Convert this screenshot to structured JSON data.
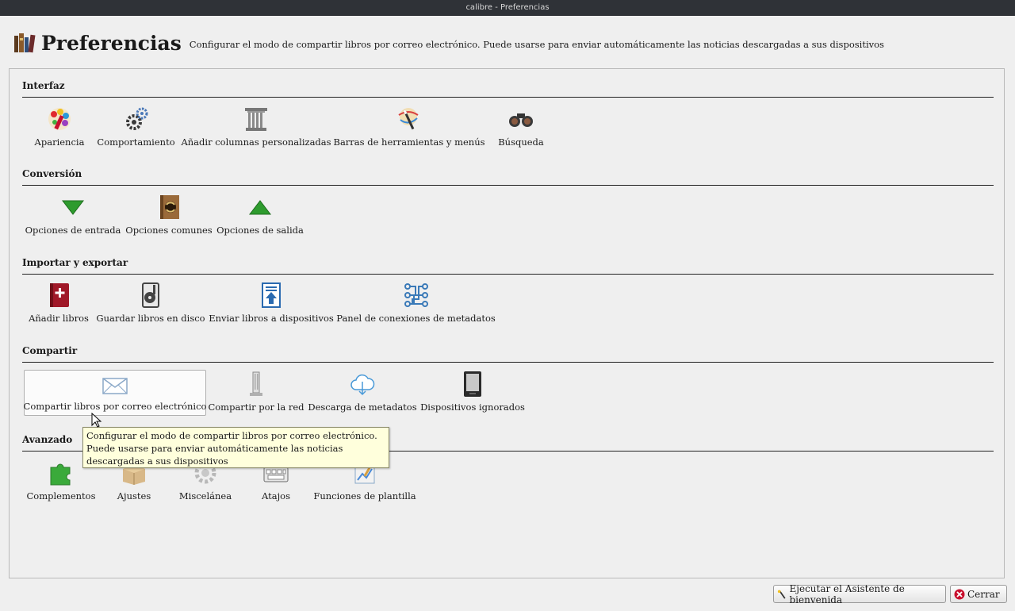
{
  "window": {
    "title": "calibre - Preferencias"
  },
  "header": {
    "title": "Preferencias",
    "description": "Configurar el modo de compartir libros por correo electrónico. Puede usarse para enviar automáticamente las noticias descargadas a sus dispositivos"
  },
  "sections": [
    {
      "title": "Interfaz",
      "items": [
        {
          "label": "Apariencia",
          "icon": "palette-icon"
        },
        {
          "label": "Comportamiento",
          "icon": "gears-icon"
        },
        {
          "label": "Añadir columnas personalizadas",
          "icon": "column-icon"
        },
        {
          "label": "Barras de herramientas y menús",
          "icon": "wand-icon"
        },
        {
          "label": "Búsqueda",
          "icon": "binoculars-icon"
        }
      ]
    },
    {
      "title": "Conversión",
      "items": [
        {
          "label": "Opciones de entrada",
          "icon": "arrow-down-icon"
        },
        {
          "label": "Opciones comunes",
          "icon": "book-convert-icon"
        },
        {
          "label": "Opciones de salida",
          "icon": "arrow-up-icon"
        }
      ]
    },
    {
      "title": "Importar y exportar",
      "items": [
        {
          "label": "Añadir libros",
          "icon": "add-book-icon"
        },
        {
          "label": "Guardar libros en disco",
          "icon": "save-disk-icon"
        },
        {
          "label": "Enviar libros a dispositivos",
          "icon": "send-device-icon"
        },
        {
          "label": "Panel de conexiones de metadatos",
          "icon": "plugboard-icon"
        }
      ]
    },
    {
      "title": "Compartir",
      "items": [
        {
          "label": "Compartir libros por correo electrónico",
          "icon": "mail-icon"
        },
        {
          "label": "Compartir por la red",
          "icon": "network-icon"
        },
        {
          "label": "Descarga de metadatos",
          "icon": "cloud-download-icon"
        },
        {
          "label": "Dispositivos ignorados",
          "icon": "reader-device-icon"
        }
      ]
    },
    {
      "title": "Avanzado",
      "items": [
        {
          "label": "Complementos",
          "icon": "puzzle-icon"
        },
        {
          "label": "Ajustes",
          "icon": "tweaks-box-icon"
        },
        {
          "label": "Miscelánea",
          "icon": "misc-gear-icon"
        },
        {
          "label": "Atajos",
          "icon": "keyboard-icon"
        },
        {
          "label": "Funciones de plantilla",
          "icon": "template-icon"
        }
      ]
    }
  ],
  "tooltip": {
    "text": "Configurar el modo de compartir libros por correo electrónico. Puede usarse para enviar automáticamente las noticias descargadas a sus dispositivos"
  },
  "footer": {
    "wizard_label": "Ejecutar el Asistente de bienvenida",
    "close_label": "Cerrar"
  },
  "colors": {
    "accent_green": "#2e9b2e",
    "tooltip_bg": "#ffffdc",
    "close_red": "#c8102e"
  }
}
